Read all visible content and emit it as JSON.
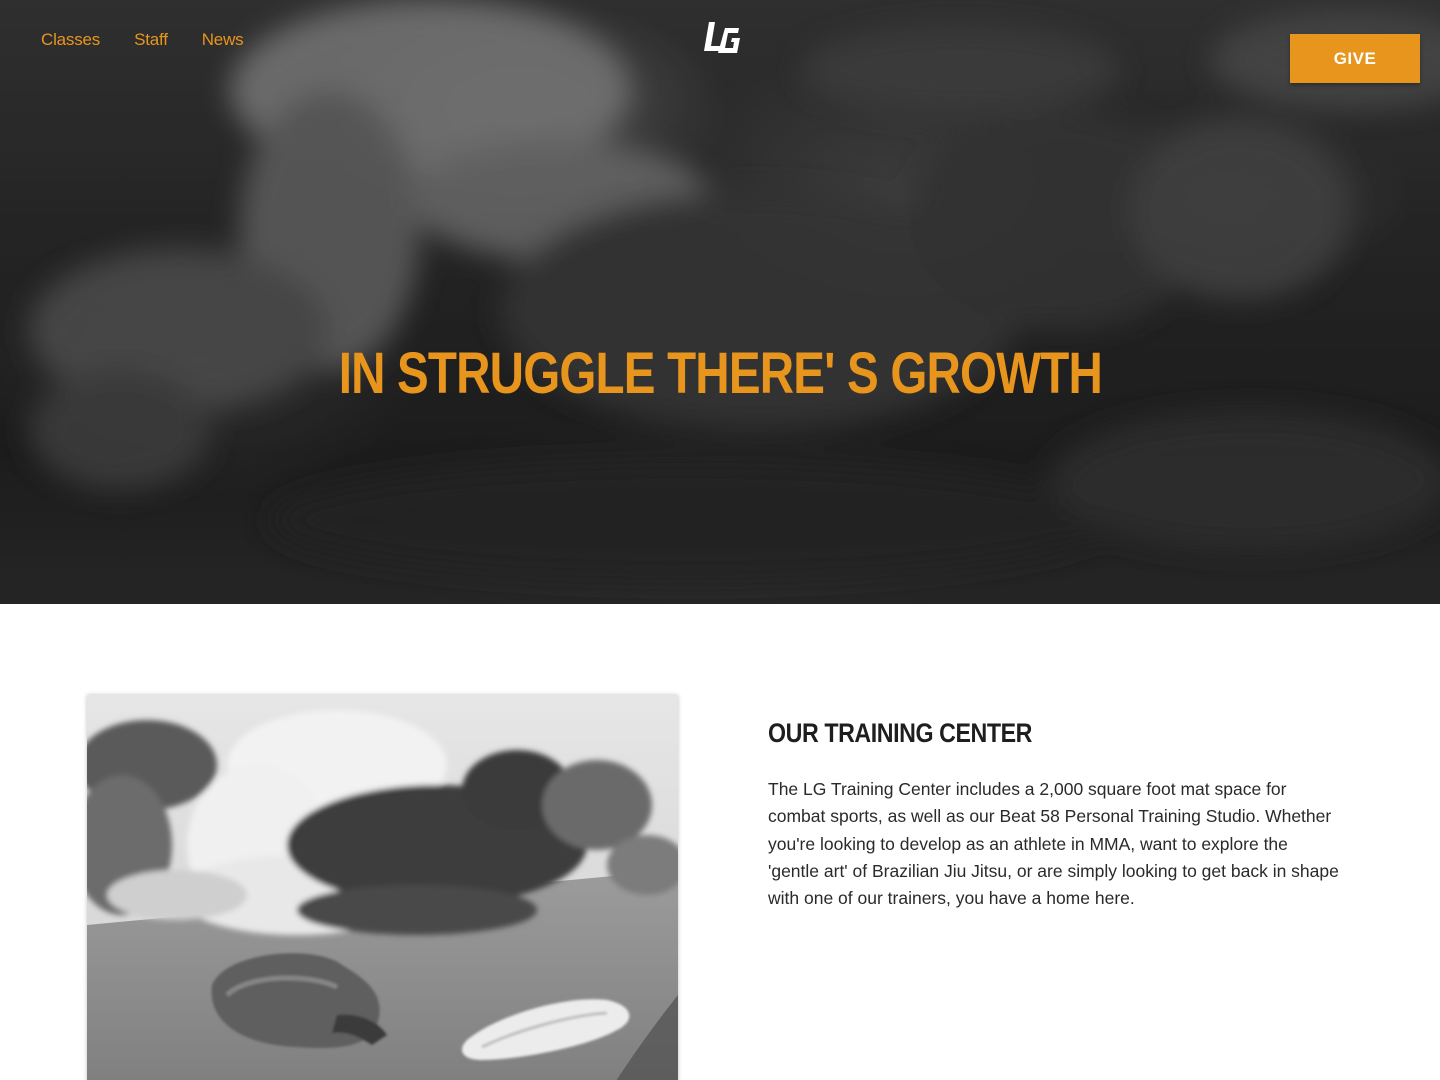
{
  "header": {
    "nav": [
      {
        "label": "Classes"
      },
      {
        "label": "Staff"
      },
      {
        "label": "News"
      }
    ],
    "logo_text": "LG",
    "give_label": "GIVE"
  },
  "hero": {
    "title": "IN STRUGGLE THERE' S GROWTH"
  },
  "training": {
    "title": "OUR TRAINING CENTER",
    "body": "The LG Training Center includes a 2,000 square foot mat space for combat sports, as well as our Beat 58 Personal Training Studio. Whether you're looking to develop as an athlete in MMA, want to explore the 'gentle art' of Brazilian Jiu Jitsu, or are simply looking to get back in shape with one of our trainers, you have a home here."
  },
  "colors": {
    "accent": "#e8951e",
    "hero_dark": "#2c2c2c",
    "heading_text": "#1e1e1e",
    "body_text": "#2a2a2a"
  }
}
